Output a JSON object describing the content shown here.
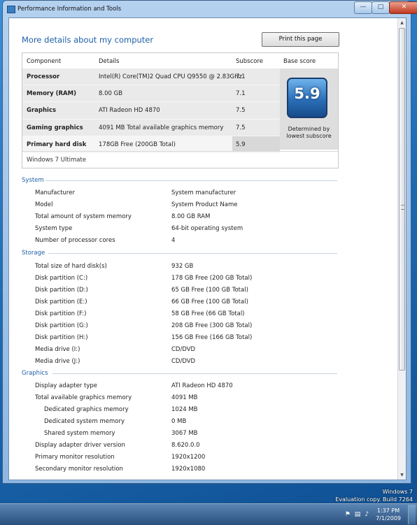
{
  "window": {
    "title": "Performance Information and Tools"
  },
  "header": {
    "title": "More details about my computer",
    "print_label": "Print this page"
  },
  "score_table": {
    "headers": {
      "component": "Component",
      "details": "Details",
      "subscore": "Subscore",
      "base": "Base score"
    },
    "rows": [
      {
        "component": "Processor",
        "details": "Intel(R) Core(TM)2 Quad CPU Q9550 @ 2.83GHz",
        "subscore": "7.1"
      },
      {
        "component": "Memory (RAM)",
        "details": "8.00 GB",
        "subscore": "7.1"
      },
      {
        "component": "Graphics",
        "details": "ATI Radeon HD 4870",
        "subscore": "7.5"
      },
      {
        "component": "Gaming graphics",
        "details": "4091 MB Total available graphics memory",
        "subscore": "7.5"
      },
      {
        "component": "Primary hard disk",
        "details": "178GB Free (200GB Total)",
        "subscore": "5.9"
      }
    ],
    "base_score": "5.9",
    "base_caption_1": "Determined by",
    "base_caption_2": "lowest subscore",
    "os": "Windows 7 Ultimate"
  },
  "system": {
    "title": "System",
    "items": [
      {
        "label": "Manufacturer",
        "value": "System manufacturer"
      },
      {
        "label": "Model",
        "value": "System Product Name"
      },
      {
        "label": "Total amount of system memory",
        "value": "8.00 GB RAM"
      },
      {
        "label": "System type",
        "value": "64-bit operating system"
      },
      {
        "label": "Number of processor cores",
        "value": "4"
      }
    ]
  },
  "storage": {
    "title": "Storage",
    "items": [
      {
        "label": "Total size of hard disk(s)",
        "value": "932 GB"
      },
      {
        "label": "Disk partition (C:)",
        "value": "178 GB Free (200 GB Total)"
      },
      {
        "label": "Disk partition (D:)",
        "value": "65 GB Free (100 GB Total)"
      },
      {
        "label": "Disk partition (E:)",
        "value": "66 GB Free (100 GB Total)"
      },
      {
        "label": "Disk partition (F:)",
        "value": "58 GB Free (66 GB Total)"
      },
      {
        "label": "Disk partition (G:)",
        "value": "208 GB Free (300 GB Total)"
      },
      {
        "label": "Disk partition (H:)",
        "value": "156 GB Free (166 GB Total)"
      },
      {
        "label": "Media drive (I:)",
        "value": "CD/DVD"
      },
      {
        "label": "Media drive (J:)",
        "value": "CD/DVD"
      }
    ]
  },
  "graphics": {
    "title": "Graphics",
    "items": [
      {
        "label": "Display adapter type",
        "value": "ATI Radeon HD 4870"
      },
      {
        "label": "Total available graphics memory",
        "value": "4091 MB"
      },
      {
        "label": "Dedicated graphics memory",
        "value": "1024 MB"
      },
      {
        "label": "Dedicated system memory",
        "value": "0 MB"
      },
      {
        "label": "Shared system memory",
        "value": "3067 MB"
      },
      {
        "label": "Display adapter driver version",
        "value": "8.620.0.0"
      },
      {
        "label": "Primary monitor resolution",
        "value": "1920x1200"
      },
      {
        "label": "Secondary monitor resolution",
        "value": "1920x1080"
      }
    ]
  },
  "desktop": {
    "watermark_line1": "Windows 7",
    "watermark_line2": "Evaluation copy. Build 7264",
    "time": "1:37 PM",
    "date": "7/1/2009"
  }
}
